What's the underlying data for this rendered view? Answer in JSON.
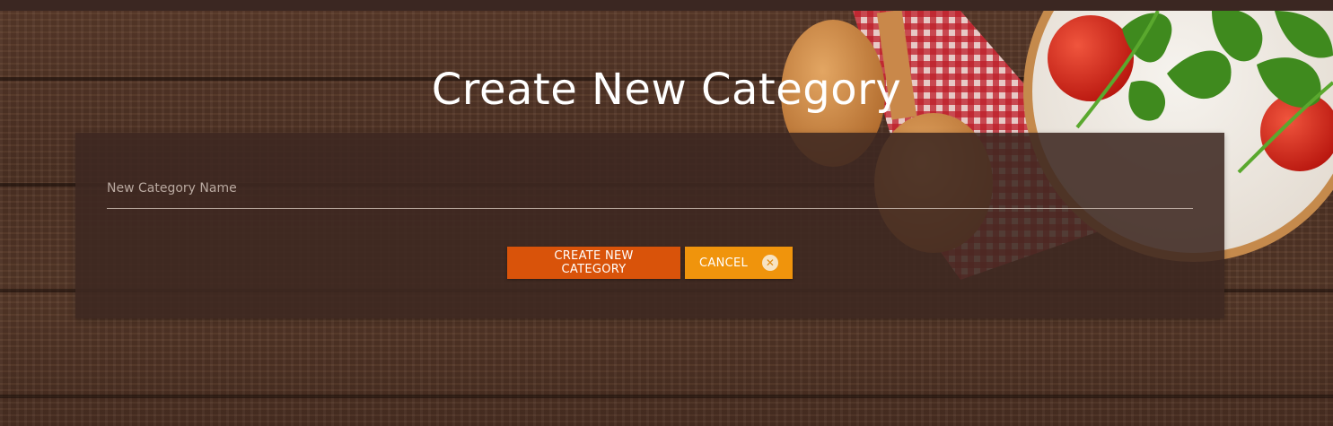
{
  "page": {
    "title": "Create New Category"
  },
  "form": {
    "name_field": {
      "placeholder": "New Category Name",
      "value": ""
    },
    "create_button_label": "CREATE NEW CATEGORY",
    "cancel_button_label": "CANCEL",
    "cancel_icon": "close-circle-icon"
  },
  "colors": {
    "create_button": "#d9530a",
    "cancel_button": "#f0940c",
    "panel": "#3e2821",
    "top_bar": "#3b2722"
  }
}
